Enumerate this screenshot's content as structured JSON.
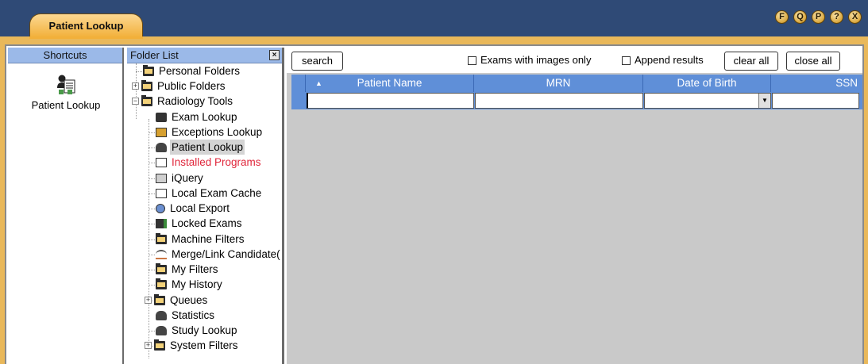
{
  "window": {
    "tab_title": "Patient Lookup",
    "buttons": [
      "F",
      "Q",
      "P",
      "?",
      "X"
    ]
  },
  "shortcuts": {
    "header": "Shortcuts",
    "items": [
      {
        "label": "Patient Lookup",
        "icon": "patient-lookup-icon"
      }
    ]
  },
  "folders": {
    "header": "Folder List",
    "close": "×",
    "items": [
      {
        "label": "Personal Folders"
      },
      {
        "label": "Public Folders"
      },
      {
        "label": "Radiology Tools"
      },
      {
        "label": "Exam Lookup"
      },
      {
        "label": "Exceptions Lookup"
      },
      {
        "label": "Patient Lookup"
      },
      {
        "label": "Installed Programs"
      },
      {
        "label": "iQuery"
      },
      {
        "label": "Local Exam Cache"
      },
      {
        "label": "Local Export"
      },
      {
        "label": "Locked Exams"
      },
      {
        "label": "Machine Filters"
      },
      {
        "label": "Merge/Link Candidate("
      },
      {
        "label": "My Filters"
      },
      {
        "label": "My History"
      },
      {
        "label": "Queues"
      },
      {
        "label": "Statistics"
      },
      {
        "label": "Study Lookup"
      },
      {
        "label": "System Filters"
      }
    ]
  },
  "toolbar": {
    "search": "search",
    "images_only": "Exams with images only",
    "append": "Append results",
    "clear_all": "clear all",
    "close_all": "close all"
  },
  "grid": {
    "sort_indicator": "▲",
    "columns": [
      "Patient Name",
      "MRN",
      "Date of Birth",
      "SSN"
    ],
    "dropdown": "▼"
  },
  "colors": {
    "title_bar": "#2f4a76",
    "frame": "#e9b85a",
    "header_blue": "#5f8fd8",
    "selected_red": "#e0263b"
  }
}
